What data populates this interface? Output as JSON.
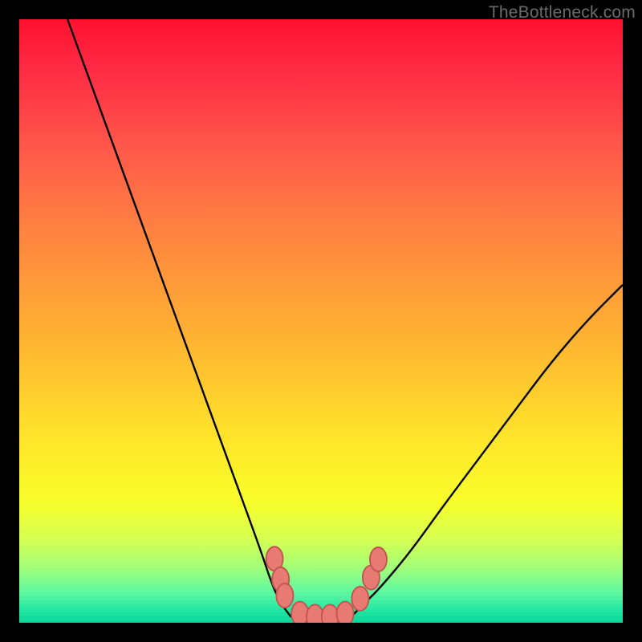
{
  "watermark": {
    "text": "TheBottleneck.com"
  },
  "colors": {
    "background": "#000000",
    "curve": "#000000",
    "bead_fill": "#e77a72",
    "bead_stroke": "#c2564f",
    "gradient_top": "#ff1130",
    "gradient_mid": "#ffe62a",
    "gradient_bottom": "#09d79a"
  },
  "chart_data": {
    "type": "line",
    "title": "",
    "xlabel": "",
    "ylabel": "",
    "xlim": [
      0,
      100
    ],
    "ylim": [
      0,
      100
    ],
    "grid": false,
    "legend": false,
    "series": [
      {
        "name": "left-branch",
        "x": [
          8,
          12,
          16,
          20,
          24,
          28,
          32,
          36,
          40,
          42,
          43.5,
          45
        ],
        "y": [
          100,
          89,
          78,
          67,
          56,
          45,
          34,
          23,
          12,
          6,
          3,
          1
        ]
      },
      {
        "name": "valley-floor",
        "x": [
          45,
          47,
          49,
          51,
          53,
          55
        ],
        "y": [
          1,
          0.4,
          0.2,
          0.2,
          0.4,
          1
        ]
      },
      {
        "name": "right-branch",
        "x": [
          55,
          57,
          60,
          65,
          70,
          76,
          82,
          88,
          94,
          100
        ],
        "y": [
          1,
          3,
          6,
          12,
          19,
          27,
          35,
          43,
          50,
          56
        ]
      }
    ],
    "markers": {
      "name": "beads",
      "points": [
        {
          "x": 42.3,
          "y": 10.6
        },
        {
          "x": 43.3,
          "y": 7.2
        },
        {
          "x": 44.0,
          "y": 4.5
        },
        {
          "x": 46.5,
          "y": 1.5
        },
        {
          "x": 49.0,
          "y": 1.0
        },
        {
          "x": 51.5,
          "y": 1.0
        },
        {
          "x": 54.0,
          "y": 1.5
        },
        {
          "x": 56.5,
          "y": 4.0
        },
        {
          "x": 58.3,
          "y": 7.5
        },
        {
          "x": 59.5,
          "y": 10.5
        }
      ],
      "rx": 1.4,
      "ry": 2.0
    }
  }
}
